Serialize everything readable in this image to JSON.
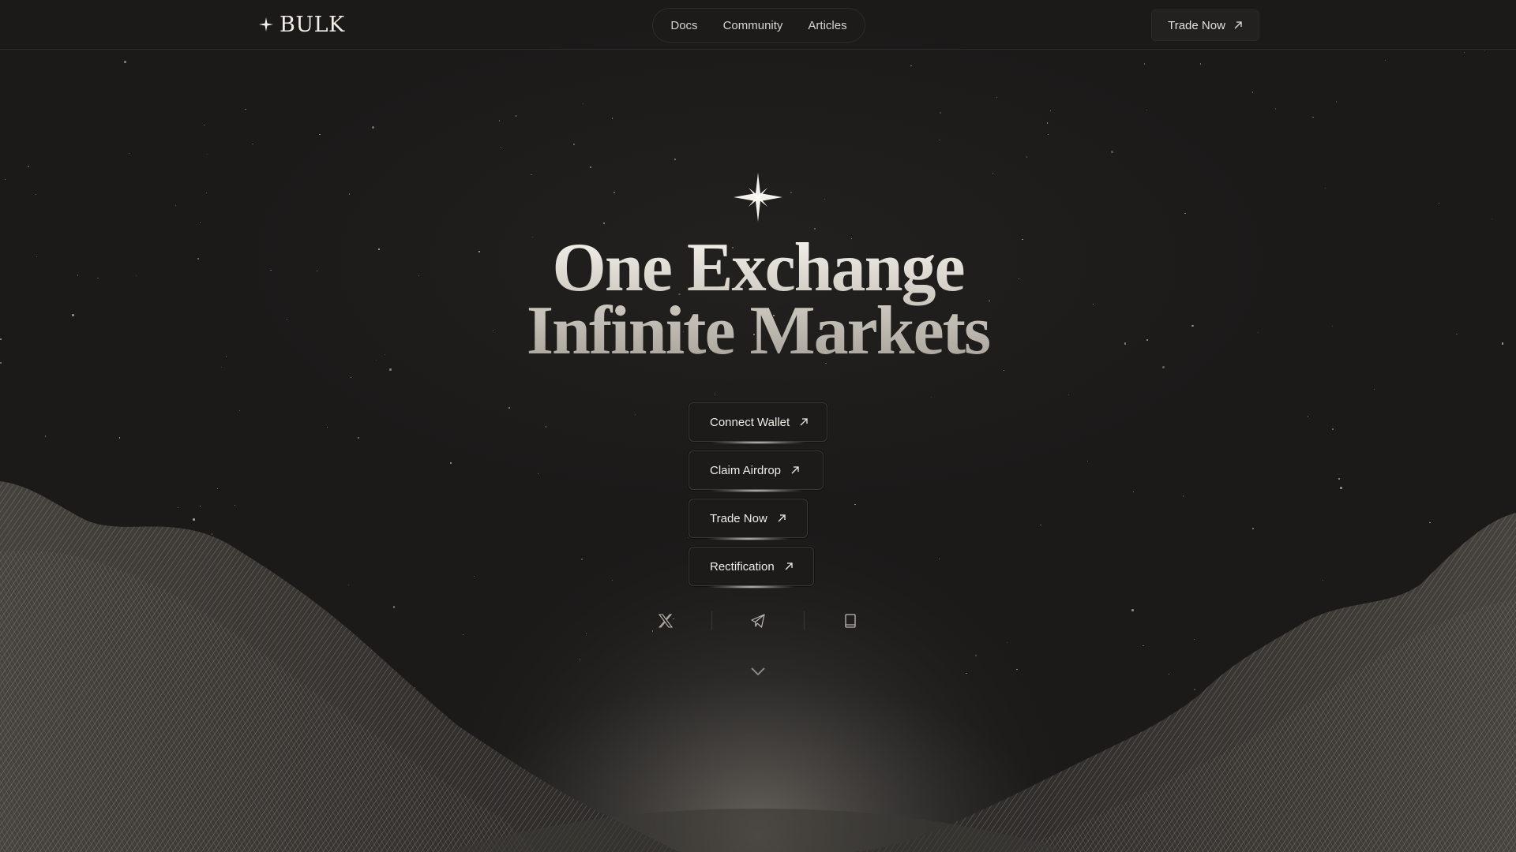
{
  "header": {
    "brand": "BULK",
    "nav": [
      "Docs",
      "Community",
      "Articles"
    ],
    "cta_label": "Trade Now"
  },
  "hero": {
    "headline_line1": "One Exchange",
    "headline_line2": "Infinite Markets",
    "buttons": [
      "Connect Wallet",
      "Claim Airdrop",
      "Trade Now",
      "Rectification"
    ]
  },
  "socials": {
    "icons": [
      "x-icon",
      "telegram-icon",
      "docs-book-icon"
    ]
  },
  "colors": {
    "background": "#1b1a19",
    "text": "#e9e6e0",
    "border": "#3a3835"
  }
}
